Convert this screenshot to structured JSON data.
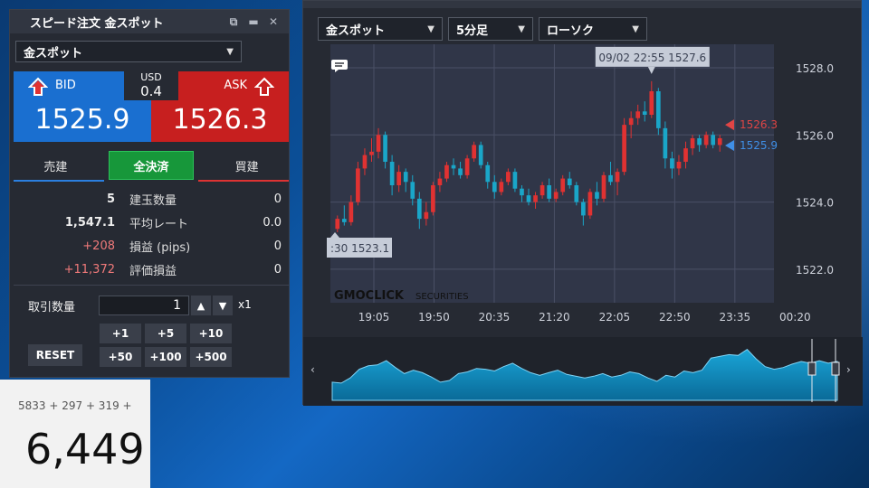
{
  "order_panel": {
    "title": "スピード注文 金スポット",
    "symbol": "金スポット",
    "bid_label": "BID",
    "ask_label": "ASK",
    "bid_price": "1525.9",
    "ask_price": "1526.3",
    "spread_currency": "USD",
    "spread_value": "0.4",
    "tabs": [
      "売建",
      "全決済",
      "買建"
    ],
    "stats": [
      {
        "left": "5",
        "label": "建玉数量",
        "right": "0",
        "positive": false
      },
      {
        "left": "1,547.1",
        "label": "平均レート",
        "right": "0.0",
        "positive": false
      },
      {
        "left": "+208",
        "label": "損益 (pips)",
        "right": "0",
        "positive": true
      },
      {
        "left": "+11,372",
        "label": "評価損益",
        "right": "0",
        "positive": true
      }
    ],
    "qty_label": "取引数量",
    "qty_value": "1",
    "qty_mult": "x1",
    "steps_row1": [
      "+1",
      "+5",
      "+10"
    ],
    "steps_row2": [
      "+50",
      "+100",
      "+500"
    ],
    "reset_label": "RESET"
  },
  "calculator": {
    "expression": "5833 + 297 + 319 +",
    "result": "6,449"
  },
  "chart_window": {
    "symbol": "金スポット",
    "timeframe": "5分足",
    "style": "ローソク",
    "watermark": "GMOCLICK",
    "watermark_suffix": "SECURITIES",
    "tooltip_high": "09/02 22:55 1527.6",
    "tooltip_low": ":30 1523.1",
    "ask_marker": "1526.3",
    "bid_marker": "1525.9"
  },
  "colors": {
    "bid": "#1a6fd0",
    "ask": "#c71f1f",
    "up_candle": "#e03232",
    "down_candle": "#1aa6c8",
    "accent_green": "#17973a"
  },
  "chart_data": {
    "type": "candlestick",
    "x_ticks": [
      "19:05",
      "19:50",
      "20:35",
      "21:20",
      "22:05",
      "22:50",
      "23:35",
      "00:20"
    ],
    "y_ticks": [
      1522.0,
      1524.0,
      1526.0,
      1528.0
    ],
    "ylim": [
      1521.0,
      1528.7
    ],
    "grid": true,
    "candles": [
      [
        1523.2,
        1523.6,
        1523.1,
        1523.5
      ],
      [
        1523.5,
        1523.9,
        1523.3,
        1523.4
      ],
      [
        1523.4,
        1524.2,
        1523.3,
        1524.0
      ],
      [
        1524.0,
        1525.2,
        1523.9,
        1525.0
      ],
      [
        1525.0,
        1525.6,
        1524.8,
        1525.4
      ],
      [
        1525.4,
        1525.9,
        1525.2,
        1525.5
      ],
      [
        1525.5,
        1526.2,
        1525.3,
        1526.0
      ],
      [
        1526.0,
        1526.1,
        1525.0,
        1525.2
      ],
      [
        1525.2,
        1525.4,
        1524.2,
        1524.5
      ],
      [
        1524.5,
        1525.1,
        1524.3,
        1524.9
      ],
      [
        1524.9,
        1525.0,
        1524.3,
        1524.6
      ],
      [
        1524.6,
        1524.8,
        1523.9,
        1524.1
      ],
      [
        1524.1,
        1524.3,
        1523.2,
        1523.5
      ],
      [
        1523.5,
        1524.0,
        1523.3,
        1523.7
      ],
      [
        1523.7,
        1524.6,
        1523.6,
        1524.5
      ],
      [
        1524.5,
        1524.9,
        1524.3,
        1524.7
      ],
      [
        1524.7,
        1525.2,
        1524.6,
        1525.1
      ],
      [
        1525.1,
        1525.3,
        1524.8,
        1525.0
      ],
      [
        1525.0,
        1525.2,
        1524.7,
        1524.8
      ],
      [
        1524.8,
        1525.4,
        1524.7,
        1525.3
      ],
      [
        1525.3,
        1525.8,
        1525.2,
        1525.7
      ],
      [
        1525.7,
        1525.8,
        1525.0,
        1525.1
      ],
      [
        1525.1,
        1525.2,
        1524.4,
        1524.6
      ],
      [
        1524.6,
        1524.8,
        1524.1,
        1524.3
      ],
      [
        1524.3,
        1524.7,
        1524.2,
        1524.6
      ],
      [
        1524.6,
        1525.0,
        1524.5,
        1524.9
      ],
      [
        1524.9,
        1525.0,
        1524.3,
        1524.4
      ],
      [
        1524.4,
        1524.5,
        1524.0,
        1524.2
      ],
      [
        1524.2,
        1524.4,
        1523.9,
        1524.0
      ],
      [
        1524.0,
        1524.3,
        1523.8,
        1524.2
      ],
      [
        1524.2,
        1524.6,
        1524.1,
        1524.5
      ],
      [
        1524.5,
        1524.7,
        1524.0,
        1524.1
      ],
      [
        1524.1,
        1524.4,
        1524.0,
        1524.3
      ],
      [
        1524.3,
        1524.8,
        1524.2,
        1524.7
      ],
      [
        1524.7,
        1524.9,
        1524.4,
        1524.5
      ],
      [
        1524.5,
        1524.6,
        1523.9,
        1524.0
      ],
      [
        1524.0,
        1524.1,
        1523.3,
        1523.6
      ],
      [
        1523.6,
        1524.4,
        1523.5,
        1524.3
      ],
      [
        1524.3,
        1524.6,
        1523.9,
        1524.1
      ],
      [
        1524.1,
        1524.9,
        1524.0,
        1524.8
      ],
      [
        1524.8,
        1525.2,
        1524.5,
        1524.6
      ],
      [
        1524.6,
        1525.0,
        1524.2,
        1524.9
      ],
      [
        1524.9,
        1526.5,
        1524.8,
        1526.3
      ],
      [
        1526.3,
        1526.7,
        1525.9,
        1526.5
      ],
      [
        1526.5,
        1526.9,
        1526.3,
        1526.7
      ],
      [
        1526.7,
        1527.0,
        1526.4,
        1526.6
      ],
      [
        1526.6,
        1527.6,
        1526.5,
        1527.3
      ],
      [
        1527.3,
        1527.4,
        1526.0,
        1526.2
      ],
      [
        1526.2,
        1526.4,
        1525.0,
        1525.3
      ],
      [
        1525.3,
        1525.5,
        1524.7,
        1525.0
      ],
      [
        1525.0,
        1525.4,
        1524.8,
        1525.2
      ],
      [
        1525.2,
        1525.8,
        1525.0,
        1525.6
      ],
      [
        1525.6,
        1526.0,
        1525.4,
        1525.9
      ],
      [
        1525.9,
        1526.0,
        1525.5,
        1525.7
      ],
      [
        1525.7,
        1526.1,
        1525.6,
        1526.0
      ],
      [
        1526.0,
        1526.1,
        1525.6,
        1525.7
      ],
      [
        1525.7,
        1526.0,
        1525.5,
        1525.9
      ]
    ]
  }
}
